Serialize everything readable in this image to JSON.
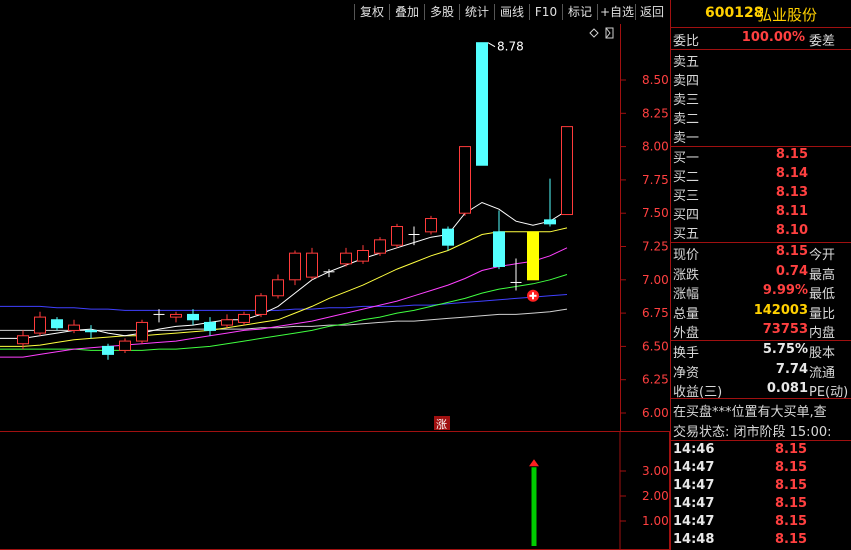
{
  "toolbar": {
    "buttons": [
      "复权",
      "叠加",
      "多股",
      "统计",
      "画线",
      "F10",
      "标记",
      "+自选",
      "返回"
    ]
  },
  "stock": {
    "code": "600128",
    "name": "弘业股份"
  },
  "order_book": {
    "ratio_label": "委比",
    "ratio_value": "100.00%",
    "diff_label": "委差",
    "sell": [
      "卖五",
      "卖四",
      "卖三",
      "卖二",
      "卖一"
    ],
    "buy": [
      {
        "label": "买一",
        "price": "8.15"
      },
      {
        "label": "买二",
        "price": "8.14"
      },
      {
        "label": "买三",
        "price": "8.13"
      },
      {
        "label": "买四",
        "price": "8.11"
      },
      {
        "label": "买五",
        "price": "8.10"
      }
    ]
  },
  "quote": {
    "rows": [
      {
        "label": "现价",
        "value": "8.15",
        "label2": "今开",
        "color": "red"
      },
      {
        "label": "涨跌",
        "value": "0.74",
        "label2": "最高",
        "color": "red"
      },
      {
        "label": "涨幅",
        "value": "9.99%",
        "label2": "最低",
        "color": "red"
      },
      {
        "label": "总量",
        "value": "142003",
        "label2": "量比",
        "color": "yellow"
      },
      {
        "label": "外盘",
        "value": "73753",
        "label2": "内盘",
        "color": "red"
      }
    ],
    "rows2": [
      {
        "label": "换手",
        "value": "5.75%",
        "label2": "股本",
        "color": "white"
      },
      {
        "label": "净资",
        "value": "7.74",
        "label2": "流通",
        "color": "white"
      },
      {
        "label": "收益(三)",
        "value": "0.081",
        "label2": "PE(动)",
        "color": "white"
      }
    ]
  },
  "messages": {
    "alert": "在买盘***位置有大买单,查",
    "status": "交易状态: 闭市阶段 15:00:"
  },
  "ticks": [
    {
      "time": "14:46",
      "price": "8.15"
    },
    {
      "time": "14:47",
      "price": "8.15"
    },
    {
      "time": "14:47",
      "price": "8.15"
    },
    {
      "time": "14:47",
      "price": "8.15"
    },
    {
      "time": "14:47",
      "price": "8.15"
    },
    {
      "time": "14:48",
      "price": "8.15"
    }
  ],
  "chart_data": {
    "type": "candlestick",
    "price_axis": {
      "ticks": [
        "8.50",
        "8.25",
        "8.00",
        "7.75",
        "7.50",
        "7.25",
        "7.00",
        "6.75",
        "6.50",
        "6.25",
        "6.00"
      ],
      "range": [
        5.9,
        8.9
      ]
    },
    "volume_axis": {
      "ticks": [
        "3.00",
        "2.00",
        "1.00"
      ],
      "range": [
        0,
        3.8
      ]
    },
    "max_label": "8.78",
    "limit_up_label": "涨",
    "colors": {
      "up": "#ff3b3b",
      "down": "#54ffff",
      "special": "#ffff00",
      "ma5": "#ffffff",
      "ma10": "#ffff40",
      "ma20": "#ff40ff",
      "ma30": "#40ff40",
      "ma60": "#4040ff",
      "ma120": "#d0d0d0"
    },
    "candles": [
      {
        "o": 6.52,
        "c": 6.58,
        "h": 6.62,
        "l": 6.48
      },
      {
        "o": 6.6,
        "c": 6.72,
        "h": 6.76,
        "l": 6.58
      },
      {
        "o": 6.7,
        "c": 6.64,
        "h": 6.72,
        "l": 6.62
      },
      {
        "o": 6.62,
        "c": 6.66,
        "h": 6.7,
        "l": 6.6
      },
      {
        "o": 6.62,
        "c": 6.61,
        "h": 6.66,
        "l": 6.56
      },
      {
        "o": 6.5,
        "c": 6.44,
        "h": 6.52,
        "l": 6.4
      },
      {
        "o": 6.47,
        "c": 6.54,
        "h": 6.56,
        "l": 6.45
      },
      {
        "o": 6.54,
        "c": 6.68,
        "h": 6.7,
        "l": 6.52
      },
      {
        "o": 6.74,
        "c": 6.74,
        "h": 6.78,
        "l": 6.68
      },
      {
        "o": 6.72,
        "c": 6.74,
        "h": 6.76,
        "l": 6.68
      },
      {
        "o": 6.74,
        "c": 6.7,
        "h": 6.78,
        "l": 6.66
      },
      {
        "o": 6.68,
        "c": 6.62,
        "h": 6.72,
        "l": 6.58
      },
      {
        "o": 6.66,
        "c": 6.7,
        "h": 6.74,
        "l": 6.64
      },
      {
        "o": 6.68,
        "c": 6.74,
        "h": 6.76,
        "l": 6.66
      },
      {
        "o": 6.74,
        "c": 6.88,
        "h": 6.9,
        "l": 6.72
      },
      {
        "o": 6.88,
        "c": 7.0,
        "h": 7.04,
        "l": 6.86
      },
      {
        "o": 7.0,
        "c": 7.2,
        "h": 7.22,
        "l": 6.96
      },
      {
        "o": 7.02,
        "c": 7.2,
        "h": 7.24,
        "l": 7.0
      },
      {
        "o": 7.06,
        "c": 7.06,
        "h": 7.08,
        "l": 7.02
      },
      {
        "o": 7.12,
        "c": 7.2,
        "h": 7.24,
        "l": 7.1
      },
      {
        "o": 7.14,
        "c": 7.22,
        "h": 7.26,
        "l": 7.12
      },
      {
        "o": 7.2,
        "c": 7.3,
        "h": 7.32,
        "l": 7.18
      },
      {
        "o": 7.26,
        "c": 7.4,
        "h": 7.42,
        "l": 7.24
      },
      {
        "o": 7.34,
        "c": 7.34,
        "h": 7.4,
        "l": 7.26
      },
      {
        "o": 7.36,
        "c": 7.46,
        "h": 7.48,
        "l": 7.34
      },
      {
        "o": 7.38,
        "c": 7.26,
        "h": 7.4,
        "l": 7.22
      },
      {
        "o": 7.5,
        "c": 8.0,
        "h": 8.0,
        "l": 7.48
      },
      {
        "o": 8.78,
        "c": 7.86,
        "h": 8.78,
        "l": 7.86
      },
      {
        "o": 7.36,
        "c": 7.1,
        "h": 7.52,
        "l": 7.08
      },
      {
        "o": 6.98,
        "c": 6.98,
        "h": 7.16,
        "l": 6.92
      },
      {
        "o": 7.0,
        "c": 7.36,
        "h": 7.36,
        "l": 7.0
      },
      {
        "o": 7.45,
        "c": 7.42,
        "h": 7.76,
        "l": 7.4
      },
      {
        "o": 7.49,
        "c": 8.15,
        "h": 8.15,
        "l": 7.49
      }
    ],
    "special_index": 30,
    "ma5": [
      6.56,
      6.58,
      6.6,
      6.62,
      6.63,
      6.6,
      6.58,
      6.6,
      6.63,
      6.65,
      6.66,
      6.68,
      6.7,
      6.7,
      6.74,
      6.8,
      6.9,
      7.0,
      7.06,
      7.11,
      7.16,
      7.2,
      7.24,
      7.28,
      7.32,
      7.34,
      7.5,
      7.58,
      7.53,
      7.44,
      7.41,
      7.44,
      7.52
    ],
    "ma10": [
      6.5,
      6.51,
      6.53,
      6.55,
      6.56,
      6.57,
      6.58,
      6.58,
      6.59,
      6.6,
      6.61,
      6.62,
      6.64,
      6.66,
      6.68,
      6.7,
      6.75,
      6.8,
      6.86,
      6.91,
      6.96,
      7.02,
      7.08,
      7.13,
      7.18,
      7.22,
      7.28,
      7.34,
      7.36,
      7.36,
      7.36,
      7.36,
      7.39
    ],
    "ma20": [
      6.42,
      6.44,
      6.46,
      6.48,
      6.49,
      6.5,
      6.51,
      6.52,
      6.53,
      6.54,
      6.56,
      6.58,
      6.6,
      6.62,
      6.63,
      6.65,
      6.67,
      6.69,
      6.72,
      6.75,
      6.78,
      6.81,
      6.84,
      6.88,
      6.92,
      6.96,
      7.01,
      7.07,
      7.1,
      7.12,
      7.14,
      7.18,
      7.24
    ],
    "ma30": [
      6.48,
      6.48,
      6.48,
      6.48,
      6.47,
      6.47,
      6.47,
      6.47,
      6.48,
      6.48,
      6.49,
      6.5,
      6.52,
      6.54,
      6.56,
      6.58,
      6.6,
      6.62,
      6.65,
      6.67,
      6.7,
      6.72,
      6.75,
      6.77,
      6.8,
      6.83,
      6.86,
      6.9,
      6.93,
      6.95,
      6.97,
      7.0,
      7.04
    ],
    "ma60": [
      6.8,
      6.8,
      6.79,
      6.79,
      6.78,
      6.78,
      6.77,
      6.77,
      6.77,
      6.77,
      6.77,
      6.77,
      6.77,
      6.77,
      6.77,
      6.77,
      6.78,
      6.78,
      6.79,
      6.79,
      6.8,
      6.8,
      6.8,
      6.81,
      6.81,
      6.82,
      6.83,
      6.84,
      6.85,
      6.86,
      6.87,
      6.88,
      6.89
    ],
    "ma120": [
      6.62,
      6.62,
      6.62,
      6.62,
      6.62,
      6.62,
      6.62,
      6.62,
      6.62,
      6.62,
      6.63,
      6.63,
      6.63,
      6.63,
      6.64,
      6.64,
      6.65,
      6.65,
      6.66,
      6.66,
      6.67,
      6.68,
      6.69,
      6.69,
      6.7,
      6.71,
      6.72,
      6.73,
      6.74,
      6.74,
      6.75,
      6.76,
      6.78
    ],
    "volume": [
      0,
      0,
      0,
      0,
      0,
      0,
      0,
      0,
      0,
      0,
      0,
      0,
      0,
      0,
      0,
      0,
      0,
      0,
      0,
      0,
      0,
      0,
      0,
      0,
      0,
      0,
      0,
      0,
      0,
      0,
      0,
      0,
      0,
      0,
      0,
      0,
      0,
      0,
      0,
      0,
      0,
      0,
      0,
      0,
      0,
      0,
      0,
      0,
      0,
      0,
      0,
      0,
      0,
      0,
      0,
      0,
      0,
      0,
      0,
      0,
      0,
      0,
      0,
      0,
      0,
      0,
      0,
      0,
      0,
      0,
      0,
      0,
      0,
      0,
      0,
      0,
      0,
      0,
      0,
      0,
      0,
      0,
      0,
      0,
      0,
      0,
      0,
      0,
      0,
      0,
      0,
      0,
      0,
      0,
      0,
      0,
      0,
      0,
      0,
      3.15
    ],
    "volume_bar_color": "#00cc00"
  }
}
